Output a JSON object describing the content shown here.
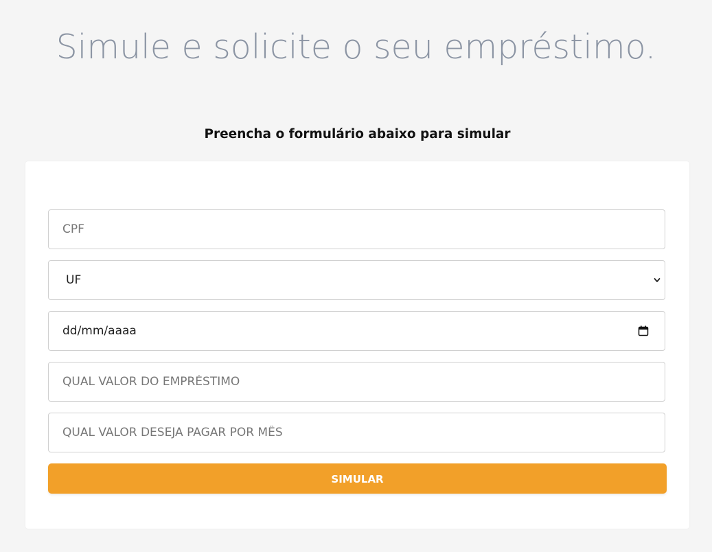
{
  "header": {
    "title": "Simule e solicite o seu empréstimo.",
    "subtitle": "Preencha o formulário abaixo para simular"
  },
  "form": {
    "cpf": {
      "placeholder": "CPF",
      "value": ""
    },
    "uf": {
      "selected": "UF"
    },
    "birth_date": {
      "display": "dd/mm/aaaa",
      "icon": "calendar-icon"
    },
    "loan_amount": {
      "placeholder": "QUAL VALOR DO EMPRÉSTIMO",
      "value": ""
    },
    "monthly_payment": {
      "placeholder": "QUAL VALOR DESEJA PAGAR POR MÊS",
      "value": ""
    },
    "submit_label": "SIMULAR"
  },
  "colors": {
    "background": "#f5f5f5",
    "card": "#ffffff",
    "accent": "#f2a029",
    "headline": "#8c95a4"
  }
}
